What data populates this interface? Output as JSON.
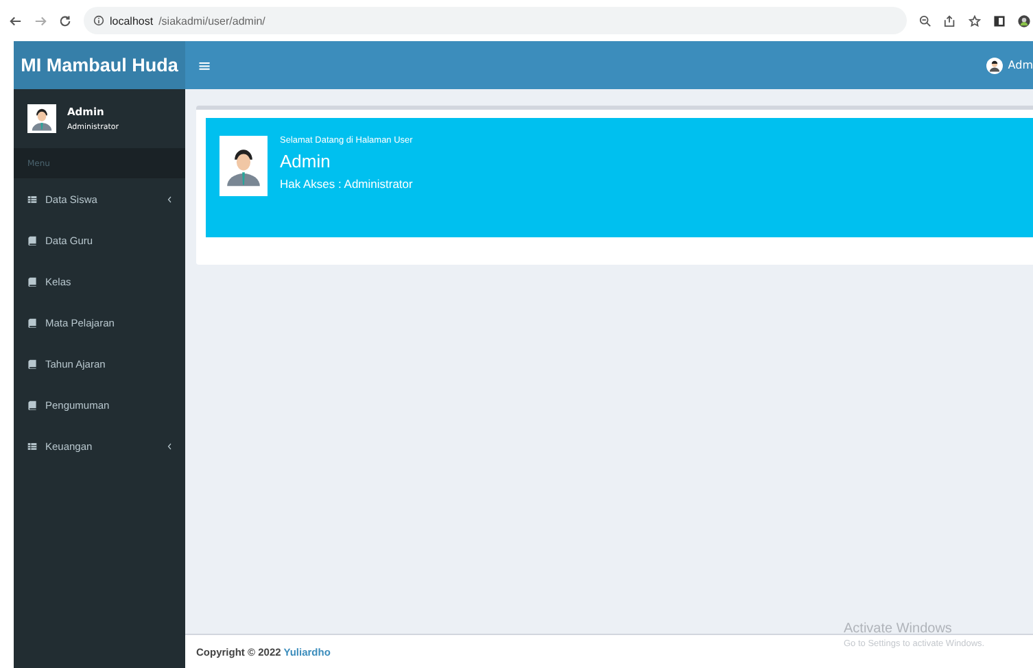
{
  "browser": {
    "url_host": "localhost",
    "url_path": "/siakadmi/user/admin/"
  },
  "header": {
    "brand": "MI Mambaul Huda",
    "menu_toggle": "≡",
    "user_name": "Adm"
  },
  "sidebar": {
    "user": {
      "name": "Admin",
      "role": "Administrator"
    },
    "section": "Menu",
    "items": [
      {
        "label": "Data Siswa",
        "kind": "table",
        "has_submenu": true
      },
      {
        "label": "Data Guru",
        "kind": "book",
        "has_submenu": false
      },
      {
        "label": "Kelas",
        "kind": "book",
        "has_submenu": false
      },
      {
        "label": "Mata Pelajaran",
        "kind": "book",
        "has_submenu": false
      },
      {
        "label": "Tahun Ajaran",
        "kind": "book",
        "has_submenu": false
      },
      {
        "label": "Pengumuman",
        "kind": "book",
        "has_submenu": false
      },
      {
        "label": "Keuangan",
        "kind": "table",
        "has_submenu": true
      }
    ]
  },
  "welcome": {
    "greeting": "Selamat Datang di Halaman User",
    "name": "Admin",
    "access": "Hak Akses : Administrator"
  },
  "footer": {
    "copyright": "Copyright © 2022",
    "author": "Yuliardho"
  },
  "os_notice": {
    "title": "Activate Windows",
    "subtitle": "Go to Settings to activate Windows."
  }
}
